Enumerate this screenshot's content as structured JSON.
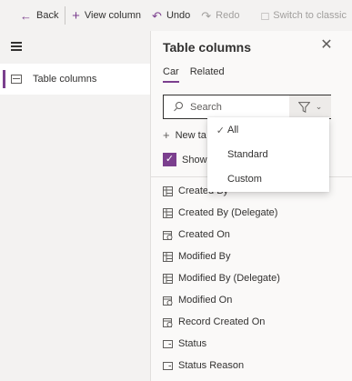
{
  "toolbar": {
    "back_label": "Back",
    "view_column_label": "View column",
    "undo_label": "Undo",
    "redo_label": "Redo",
    "switch_classic_label": "Switch to classic"
  },
  "leftnav": {
    "items": [
      {
        "label": "Table columns",
        "selected": true
      }
    ]
  },
  "panel": {
    "title": "Table columns",
    "tabs": [
      {
        "label": "Car",
        "active": true
      },
      {
        "label": "Related",
        "active": false
      }
    ],
    "search": {
      "placeholder": "Search",
      "value": ""
    },
    "new_table_label": "New ta",
    "show_label": "Show",
    "show_checked": true,
    "columns": [
      {
        "label": "Created By",
        "icon": "lookup-icon"
      },
      {
        "label": "Created By (Delegate)",
        "icon": "lookup-icon"
      },
      {
        "label": "Created On",
        "icon": "datetime-icon"
      },
      {
        "label": "Modified By",
        "icon": "lookup-icon"
      },
      {
        "label": "Modified By (Delegate)",
        "icon": "lookup-icon"
      },
      {
        "label": "Modified On",
        "icon": "datetime-icon"
      },
      {
        "label": "Record Created On",
        "icon": "datetime-icon"
      },
      {
        "label": "Status",
        "icon": "choice-icon"
      },
      {
        "label": "Status Reason",
        "icon": "choice-icon"
      }
    ]
  },
  "filter_menu": {
    "options": [
      {
        "label": "All",
        "selected": true
      },
      {
        "label": "Standard",
        "selected": false
      },
      {
        "label": "Custom",
        "selected": false
      }
    ]
  },
  "colors": {
    "accent": "#7b3f8e",
    "background": "#f3f2f1",
    "panel": "#faf9f8",
    "text": "#323130"
  }
}
